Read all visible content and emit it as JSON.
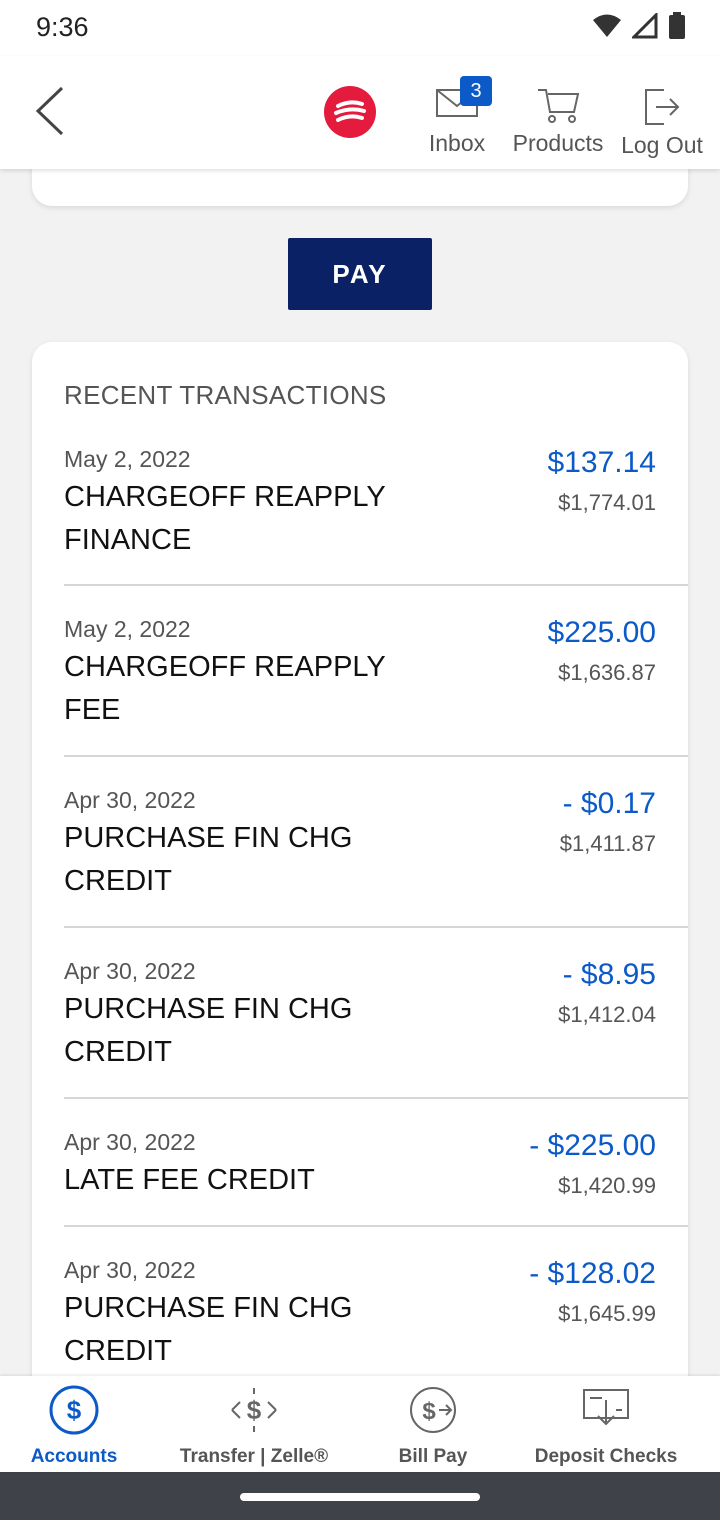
{
  "status_bar": {
    "time": "9:36"
  },
  "header": {
    "inbox": {
      "label": "Inbox",
      "badge": "3"
    },
    "products": {
      "label": "Products"
    },
    "logout": {
      "label": "Log Out"
    }
  },
  "pay_button": {
    "label": "PAY"
  },
  "transactions": {
    "heading": "RECENT TRANSACTIONS",
    "items": [
      {
        "date": "May 2, 2022",
        "description": "CHARGEOFF REAPPLY FINANCE",
        "amount": "$137.14",
        "balance": "$1,774.01"
      },
      {
        "date": "May 2, 2022",
        "description": "CHARGEOFF REAPPLY FEE",
        "amount": "$225.00",
        "balance": "$1,636.87"
      },
      {
        "date": "Apr 30, 2022",
        "description": "PURCHASE FIN CHG CREDIT",
        "amount": "- $0.17",
        "balance": "$1,411.87"
      },
      {
        "date": "Apr 30, 2022",
        "description": "PURCHASE FIN CHG CREDIT",
        "amount": "- $8.95",
        "balance": "$1,412.04"
      },
      {
        "date": "Apr 30, 2022",
        "description": "LATE FEE CREDIT",
        "amount": "- $225.00",
        "balance": "$1,420.99"
      },
      {
        "date": "Apr 30, 2022",
        "description": "PURCHASE FIN CHG CREDIT",
        "amount": "- $128.02",
        "balance": "$1,645.99"
      }
    ]
  },
  "bottom_nav": {
    "items": [
      {
        "label": "Accounts",
        "icon": "dollar-circle-icon",
        "active": true
      },
      {
        "label": "Transfer | Zelle®",
        "icon": "transfer-icon",
        "active": false
      },
      {
        "label": "Bill Pay",
        "icon": "bill-pay-icon",
        "active": false
      },
      {
        "label": "Deposit Checks",
        "icon": "deposit-check-icon",
        "active": false
      }
    ]
  },
  "colors": {
    "accent": "#0b5ac7",
    "pay_button": "#0a2265",
    "logo": "#e41b3c"
  }
}
